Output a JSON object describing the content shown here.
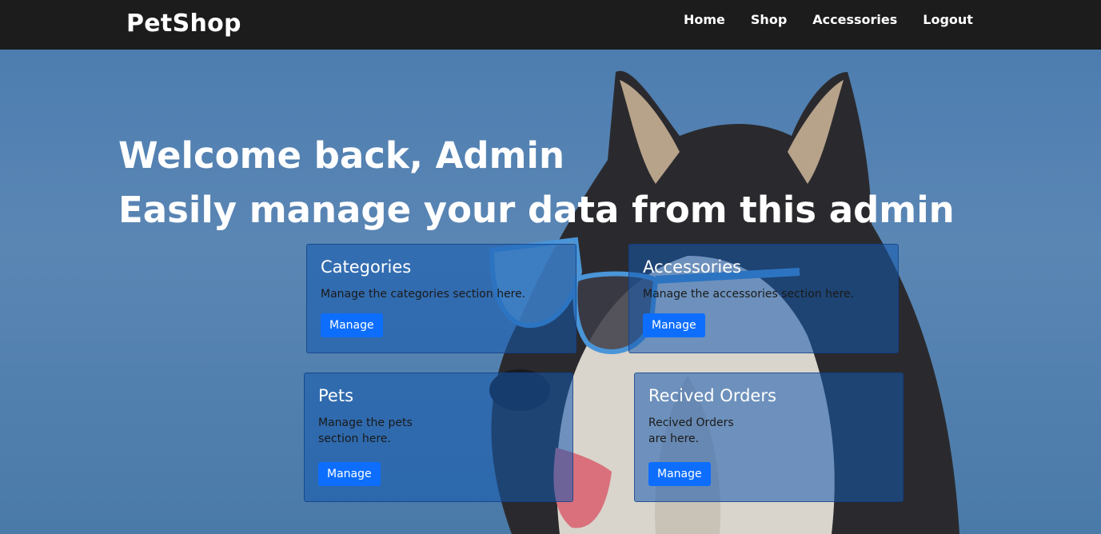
{
  "brand": "PetShop",
  "nav": {
    "home": "Home",
    "shop": "Shop",
    "accessories": "Accessories",
    "logout": "Logout"
  },
  "hero": {
    "welcome": "Welcome back, Admin",
    "subtitle": "Easily manage your data from this admin"
  },
  "cards": [
    {
      "title": "Categories",
      "text": "Manage the categories section here.",
      "button": "Manage"
    },
    {
      "title": "Accessories",
      "text": "Manage the accessories section here.",
      "button": "Manage"
    },
    {
      "title": "Pets",
      "text": "Manage the pets section here.",
      "button": "Manage"
    },
    {
      "title": "Recived Orders",
      "text": "Recived Orders are here.",
      "button": "Manage"
    }
  ],
  "colors": {
    "navbar": "#1c1c1c",
    "hero_bg": "#4f7fae",
    "button": "#0d6efd"
  }
}
